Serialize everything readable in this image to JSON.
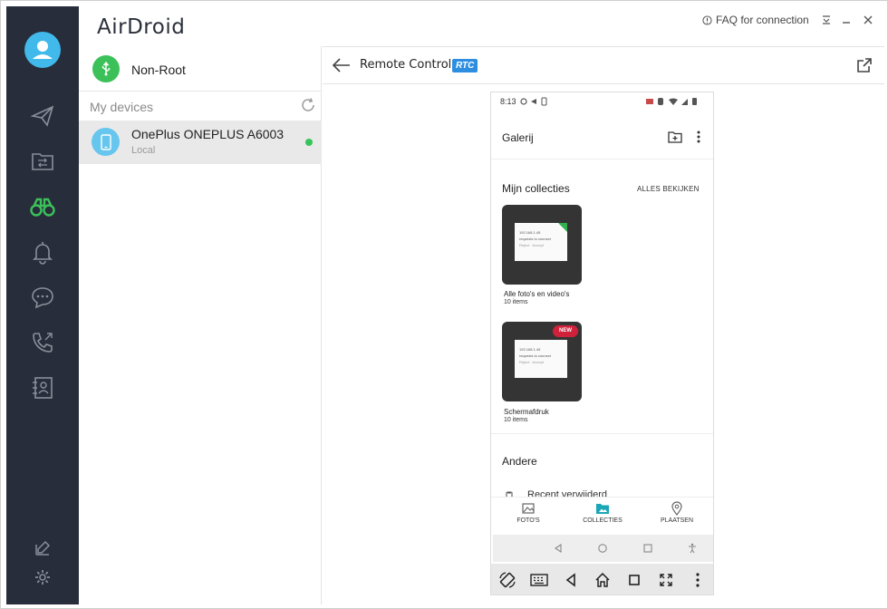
{
  "app": {
    "logo": "AirDroid",
    "faq": "FAQ for connection",
    "accent": "#3cc15a"
  },
  "rail": {
    "items": [
      "avatar-icon",
      "send-icon",
      "file-transfer-icon",
      "binoculars-icon",
      "bell-icon",
      "chat-icon",
      "call-icon",
      "contacts-icon",
      "edit-icon",
      "settings-icon"
    ],
    "active": "binoculars-icon"
  },
  "devices": {
    "mode_label": "Non-Root",
    "section_label": "My devices",
    "list": [
      {
        "name": "OnePlus ONEPLUS A6003",
        "location": "Local",
        "status": "online"
      }
    ]
  },
  "remote": {
    "title": "Remote Control",
    "badge": "RTC"
  },
  "phone": {
    "status_time": "8:13",
    "app_title": "Galerij",
    "section_collections": "Mijn collecties",
    "see_all": "ALLES BEKIJKEN",
    "albums": [
      {
        "name": "Alle foto's en video's",
        "count": "10 items",
        "badge": ""
      },
      {
        "name": "Schermafdruk",
        "count": "10 items",
        "badge": "NEW"
      }
    ],
    "album_card_lines": [
      "192.168.1.45",
      "requests to connect",
      "Reject · Accept"
    ],
    "section_other": "Andere",
    "recent": "Recent verwijderd",
    "nav": [
      "FOTO'S",
      "COLLECTIES",
      "PLAATSEN"
    ],
    "nav_active": "COLLECTIES"
  }
}
